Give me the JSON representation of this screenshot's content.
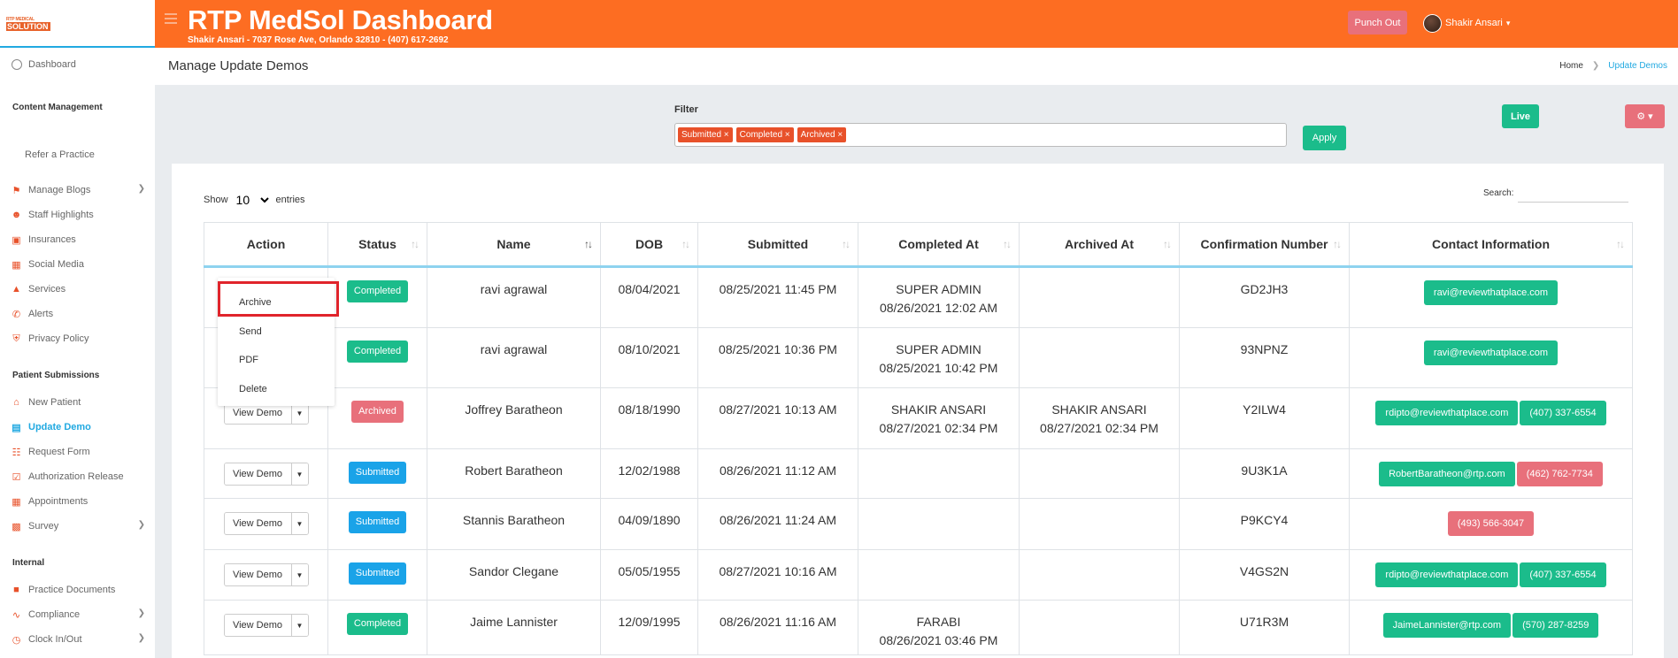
{
  "header": {
    "title": "RTP MedSol Dashboard",
    "subtitle": "Shakir Ansari - 7037 Rose Ave, Orlando 32810 - (407) 617-2692",
    "punch_out": "Punch Out",
    "user_name": "Shakir Ansari",
    "logo_top": "RTP MEDICAL",
    "logo_bottom": "SOLUTION"
  },
  "sidebar": {
    "dashboard": "Dashboard",
    "section_content": "Content Management",
    "refer": "Refer a Practice",
    "items_content": [
      {
        "label": "Manage Blogs",
        "icon": "blog-icon"
      },
      {
        "label": "Staff Highlights",
        "icon": "user-icon"
      },
      {
        "label": "Insurances",
        "icon": "briefcase-icon"
      },
      {
        "label": "Social Media",
        "icon": "social-icon"
      },
      {
        "label": "Services",
        "icon": "bell-icon"
      },
      {
        "label": "Alerts",
        "icon": "phone-icon"
      },
      {
        "label": "Privacy Policy",
        "icon": "shield-icon"
      }
    ],
    "section_patient": "Patient Submissions",
    "items_patient": [
      {
        "label": "New Patient",
        "icon": "home-icon"
      },
      {
        "label": "Update Demo",
        "icon": "id-card-icon"
      },
      {
        "label": "Request Form",
        "icon": "form-icon"
      },
      {
        "label": "Authorization Release",
        "icon": "check-doc-icon"
      },
      {
        "label": "Appointments",
        "icon": "calendar-icon"
      },
      {
        "label": "Survey",
        "icon": "chart-icon"
      }
    ],
    "section_internal": "Internal",
    "items_internal": [
      {
        "label": "Practice Documents",
        "icon": "document-icon"
      },
      {
        "label": "Compliance",
        "icon": "signature-icon"
      },
      {
        "label": "Clock In/Out",
        "icon": "clock-icon"
      }
    ]
  },
  "page": {
    "title": "Manage Update Demos",
    "breadcrumb_home": "Home",
    "breadcrumb_current": "Update Demos"
  },
  "filter": {
    "label": "Filter",
    "tags": [
      "Submitted ×",
      "Completed ×",
      "Archived ×"
    ],
    "apply": "Apply",
    "live": "Live",
    "settings": "⚙ ▾"
  },
  "table_controls": {
    "show": "Show",
    "entries_value": "10",
    "entries": "entries",
    "search": "Search:"
  },
  "table": {
    "columns": [
      "Action",
      "Status",
      "Name",
      "DOB",
      "Submitted",
      "Completed At",
      "Archived At",
      "Confirmation Number",
      "Contact Information"
    ],
    "view_demo": "View Demo",
    "rows": [
      {
        "status": "Completed",
        "name": "ravi agrawal",
        "dob": "08/04/2021",
        "submitted": "08/25/2021 11:45 PM",
        "completed_by": "SUPER ADMIN",
        "completed_at": "08/26/2021 12:02 AM",
        "archived_by": "",
        "archived_at": "",
        "confirmation": "GD2JH3",
        "email": "ravi@reviewthatplace.com",
        "phone": ""
      },
      {
        "status": "Completed",
        "name": "ravi agrawal",
        "dob": "08/10/2021",
        "submitted": "08/25/2021 10:36 PM",
        "completed_by": "SUPER ADMIN",
        "completed_at": "08/25/2021 10:42 PM",
        "archived_by": "",
        "archived_at": "",
        "confirmation": "93NPNZ",
        "email": "ravi@reviewthatplace.com",
        "phone": ""
      },
      {
        "status": "Archived",
        "name": "Joffrey Baratheon",
        "dob": "08/18/1990",
        "submitted": "08/27/2021 10:13 AM",
        "completed_by": "SHAKIR ANSARI",
        "completed_at": "08/27/2021 02:34 PM",
        "archived_by": "SHAKIR ANSARI",
        "archived_at": "08/27/2021 02:34 PM",
        "confirmation": "Y2ILW4",
        "email": "rdipto@reviewthatplace.com",
        "phone": "(407) 337-6554"
      },
      {
        "status": "Submitted",
        "name": "Robert Baratheon",
        "dob": "12/02/1988",
        "submitted": "08/26/2021 11:12 AM",
        "completed_by": "",
        "completed_at": "",
        "archived_by": "",
        "archived_at": "",
        "confirmation": "9U3K1A",
        "email": "RobertBaratheon@rtp.com",
        "phone": "(462) 762-7734"
      },
      {
        "status": "Submitted",
        "name": "Stannis Baratheon",
        "dob": "04/09/1890",
        "submitted": "08/26/2021 11:24 AM",
        "completed_by": "",
        "completed_at": "",
        "archived_by": "",
        "archived_at": "",
        "confirmation": "P9KCY4",
        "email": "",
        "phone": "(493) 566-3047"
      },
      {
        "status": "Submitted",
        "name": "Sandor Clegane",
        "dob": "05/05/1955",
        "submitted": "08/27/2021 10:16 AM",
        "completed_by": "",
        "completed_at": "",
        "archived_by": "",
        "archived_at": "",
        "confirmation": "V4GS2N",
        "email": "rdipto@reviewthatplace.com",
        "phone": "(407) 337-6554"
      },
      {
        "status": "Completed",
        "name": "Jaime Lannister",
        "dob": "12/09/1995",
        "submitted": "08/26/2021 11:16 AM",
        "completed_by": "FARABI",
        "completed_at": "08/26/2021 03:46 PM",
        "archived_by": "",
        "archived_at": "",
        "confirmation": "U71R3M",
        "email": "JaimeLannister@rtp.com",
        "phone": "(570) 287-8259"
      }
    ]
  },
  "action_menu": {
    "archive": "Archive",
    "send": "Send",
    "pdf": "PDF",
    "delete": "Delete"
  },
  "colors": {
    "brand_orange": "#fd6d22",
    "completed": "#1bbc8b",
    "archived": "#e8707b",
    "submitted": "#1aa3e8",
    "highlight": "#e0242b"
  }
}
